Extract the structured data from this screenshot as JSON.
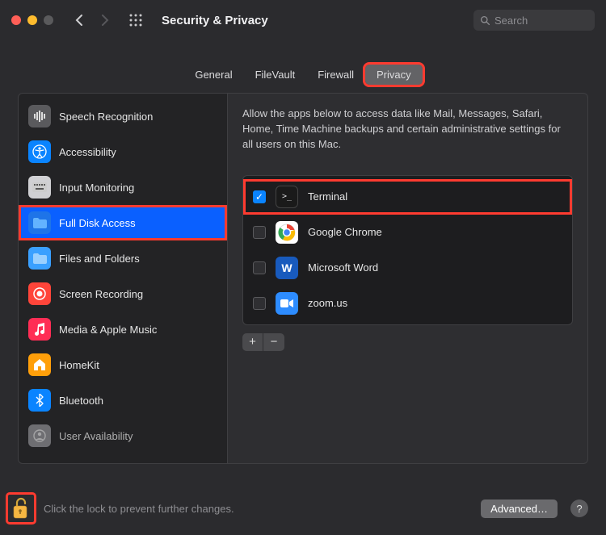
{
  "window": {
    "title": "Security & Privacy",
    "search_placeholder": "Search"
  },
  "tabs": [
    {
      "label": "General",
      "active": false
    },
    {
      "label": "FileVault",
      "active": false
    },
    {
      "label": "Firewall",
      "active": false
    },
    {
      "label": "Privacy",
      "active": true,
      "highlighted": true
    }
  ],
  "sidebar": {
    "items": [
      {
        "label": "Speech Recognition",
        "icon": "speech"
      },
      {
        "label": "Accessibility",
        "icon": "access"
      },
      {
        "label": "Input Monitoring",
        "icon": "input"
      },
      {
        "label": "Full Disk Access",
        "icon": "folder-blue",
        "selected": true,
        "highlighted": true
      },
      {
        "label": "Files and Folders",
        "icon": "folder-light"
      },
      {
        "label": "Screen Recording",
        "icon": "rec"
      },
      {
        "label": "Media & Apple Music",
        "icon": "music"
      },
      {
        "label": "HomeKit",
        "icon": "homekit"
      },
      {
        "label": "Bluetooth",
        "icon": "bt"
      },
      {
        "label": "User Availability",
        "icon": "avail"
      }
    ]
  },
  "content": {
    "description": "Allow the apps below to access data like Mail, Messages, Safari, Home, Time Machine backups and certain administrative settings for all users on this Mac.",
    "apps": [
      {
        "name": "Terminal",
        "checked": true,
        "icon": "terminal",
        "highlighted": true
      },
      {
        "name": "Google Chrome",
        "checked": false,
        "icon": "chrome"
      },
      {
        "name": "Microsoft Word",
        "checked": false,
        "icon": "word"
      },
      {
        "name": "zoom.us",
        "checked": false,
        "icon": "zoom"
      }
    ]
  },
  "footer": {
    "lock_text": "Click the lock to prevent further changes.",
    "advanced_label": "Advanced…",
    "help_label": "?"
  },
  "highlight_color": "#ff3b30"
}
